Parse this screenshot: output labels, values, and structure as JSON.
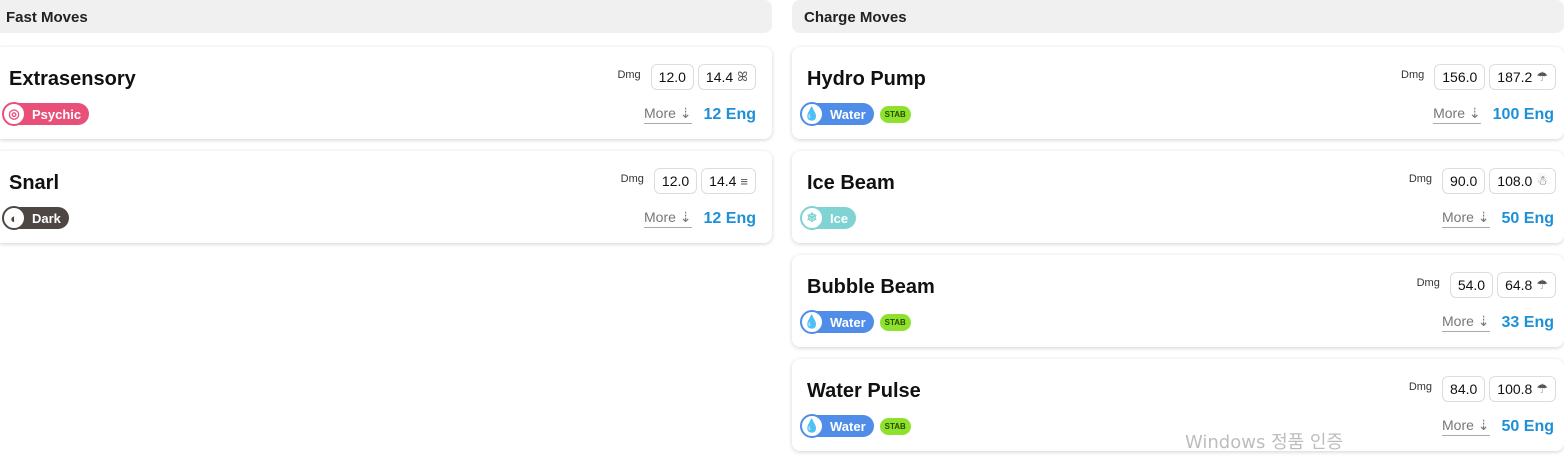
{
  "fast_moves": {
    "title": "Fast Moves",
    "moves": [
      {
        "name": "Extrasensory",
        "type": "Psychic",
        "type_color": "#e8507a",
        "type_icon": "psychic-icon",
        "type_glyph": "◎",
        "stab": "",
        "dmg_label": "Dmg",
        "dmg": "12.0",
        "dmg_weather": "14.4",
        "weather_icon": "windy-icon",
        "weather_glyph": "ꕤ",
        "more": "More ⇣",
        "energy": "12 Eng"
      },
      {
        "name": "Snarl",
        "type": "Dark",
        "type_color": "#4e4642",
        "type_icon": "dark-icon",
        "type_glyph": "◐",
        "stab": "",
        "dmg_label": "Dmg",
        "dmg": "12.0",
        "dmg_weather": "14.4",
        "weather_icon": "fog-icon",
        "weather_glyph": "≡",
        "more": "More ⇣",
        "energy": "12 Eng"
      }
    ]
  },
  "charge_moves": {
    "title": "Charge Moves",
    "moves": [
      {
        "name": "Hydro Pump",
        "type": "Water",
        "type_color": "#4f8de8",
        "type_icon": "water-icon",
        "type_glyph": "💧",
        "stab": "STAB",
        "dmg_label": "Dmg",
        "dmg": "156.0",
        "dmg_weather": "187.2",
        "weather_icon": "rain-icon",
        "weather_glyph": "☂",
        "more": "More ⇣",
        "energy": "100 Eng"
      },
      {
        "name": "Ice Beam",
        "type": "Ice",
        "type_color": "#7fd3d3",
        "type_icon": "ice-icon",
        "type_glyph": "❄",
        "stab": "",
        "dmg_label": "Dmg",
        "dmg": "90.0",
        "dmg_weather": "108.0",
        "weather_icon": "snow-icon",
        "weather_glyph": "☃",
        "more": "More ⇣",
        "energy": "50 Eng"
      },
      {
        "name": "Bubble Beam",
        "type": "Water",
        "type_color": "#4f8de8",
        "type_icon": "water-icon",
        "type_glyph": "💧",
        "stab": "STAB",
        "dmg_label": "Dmg",
        "dmg": "54.0",
        "dmg_weather": "64.8",
        "weather_icon": "rain-icon",
        "weather_glyph": "☂",
        "more": "More ⇣",
        "energy": "33 Eng"
      },
      {
        "name": "Water Pulse",
        "type": "Water",
        "type_color": "#4f8de8",
        "type_icon": "water-icon",
        "type_glyph": "💧",
        "stab": "STAB",
        "dmg_label": "Dmg",
        "dmg": "84.0",
        "dmg_weather": "100.8",
        "weather_icon": "rain-icon",
        "weather_glyph": "☂",
        "more": "More ⇣",
        "energy": "50 Eng"
      }
    ]
  },
  "watermark": "Windows 정품 인증"
}
